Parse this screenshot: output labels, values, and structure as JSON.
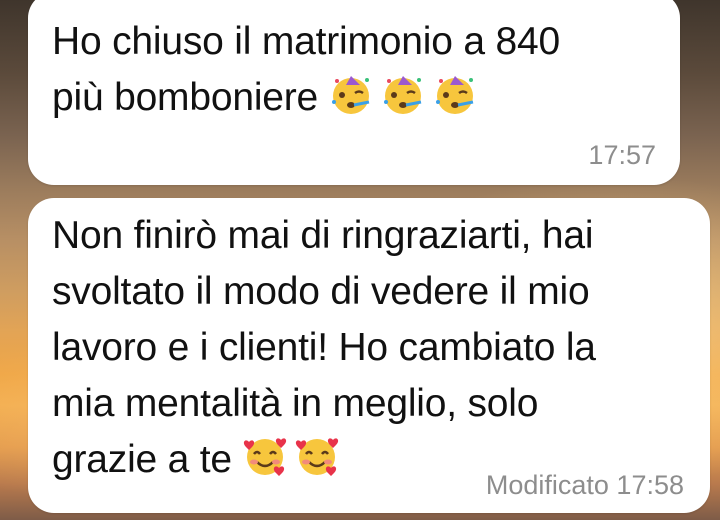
{
  "messages": [
    {
      "line1": "Ho chiuso il matrimonio a 840",
      "line2": "più bomboniere ",
      "emoji": [
        "partying-face",
        "partying-face",
        "partying-face"
      ],
      "time": "17:57"
    },
    {
      "lines": [
        "Non finirò mai di ringraziarti, hai",
        "svoltato il modo di vedere il mio",
        "lavoro e i clienti! Ho cambiato la",
        "mia mentalità in meglio, solo",
        "grazie a te "
      ],
      "emoji": [
        "smiling-face-with-hearts",
        "smiling-face-with-hearts"
      ],
      "edited": "Modificato",
      "time": "17:58"
    }
  ],
  "colors": {
    "bubble": "#ffffff",
    "timestamp": "#8d8d8d",
    "text": "#111111"
  }
}
